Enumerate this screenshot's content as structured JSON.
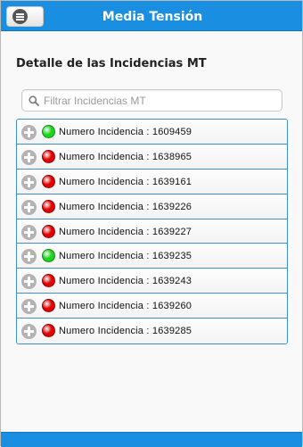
{
  "header": {
    "title": "Media Tensión",
    "menu_icon": "menu-icon"
  },
  "section": {
    "title": "Detalle de las Incidencias MT"
  },
  "search": {
    "placeholder": "Filtrar Incidencias MT",
    "value": "",
    "icon": "search-icon"
  },
  "colors": {
    "header_blue": "#1a8ee0",
    "status_green": "#1bd41b",
    "status_red": "#e00000"
  },
  "incidents": [
    {
      "label": "Numero Incidencia : 1609459",
      "status": "green"
    },
    {
      "label": "Numero Incidencia : 1638965",
      "status": "red"
    },
    {
      "label": "Numero Incidencia : 1639161",
      "status": "red"
    },
    {
      "label": "Numero Incidencia : 1639226",
      "status": "red"
    },
    {
      "label": "Numero Incidencia : 1639227",
      "status": "red"
    },
    {
      "label": "Numero Incidencia : 1639235",
      "status": "green"
    },
    {
      "label": "Numero Incidencia : 1639243",
      "status": "red"
    },
    {
      "label": "Numero Incidencia : 1639260",
      "status": "red"
    },
    {
      "label": "Numero Incidencia : 1639285",
      "status": "red"
    }
  ]
}
